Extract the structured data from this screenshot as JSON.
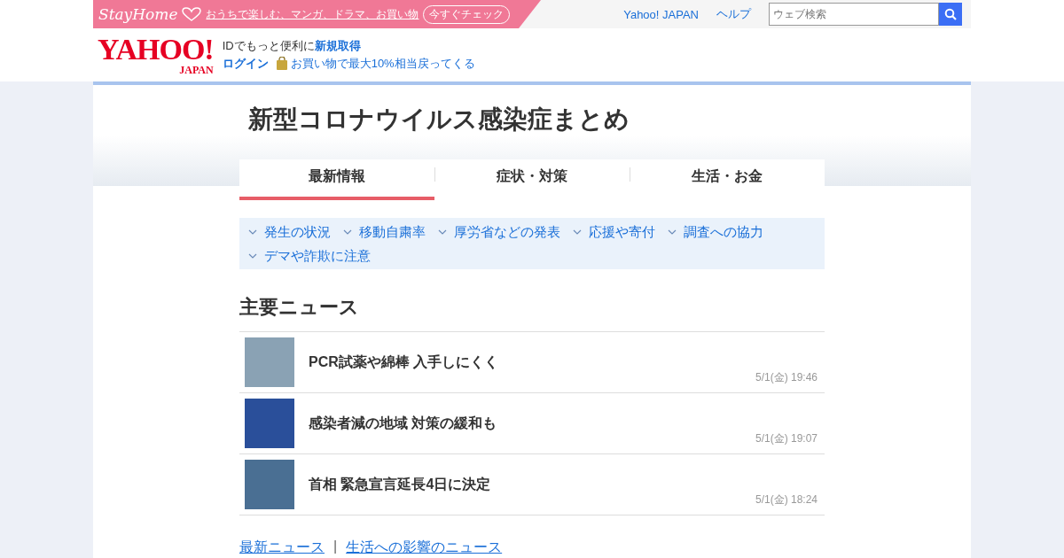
{
  "promo": {
    "logo": "StayHome",
    "text": "おうちで楽しむ、マンガ、ドラマ、お買い物",
    "button": "今すぐチェック"
  },
  "top_links": [
    "Yahoo! JAPAN",
    "ヘルプ"
  ],
  "search": {
    "placeholder": "ウェブ検索"
  },
  "logo": {
    "wordmark": "YAHOO!",
    "sub": "JAPAN"
  },
  "account": {
    "prompt": "IDでもっと便利に",
    "signup": "新規取得",
    "login": "ログイン",
    "points": "お買い物で最大10%相当戻ってくる"
  },
  "page_title": "新型コロナウイルス感染症まとめ",
  "tabs": [
    {
      "label": "最新情報",
      "selected": true
    },
    {
      "label": "症状・対策",
      "selected": false
    },
    {
      "label": "生活・お金",
      "selected": false
    }
  ],
  "subnav": [
    "発生の状況",
    "移動自粛率",
    "厚労省などの発表",
    "応援や寄付",
    "調査への協力",
    "デマや詐欺に注意"
  ],
  "section_title": "主要ニュース",
  "news": [
    {
      "headline": "PCR試薬や綿棒 入手しにくく",
      "time": "5/1(金) 19:46"
    },
    {
      "headline": "感染者減の地域 対策の緩和も",
      "time": "5/1(金) 19:07"
    },
    {
      "headline": "首相 緊急宣言延長4日に決定",
      "time": "5/1(金) 18:24"
    }
  ],
  "footer_links": [
    "最新ニュース",
    "生活への影響のニュース"
  ],
  "footer_separator": "|"
}
